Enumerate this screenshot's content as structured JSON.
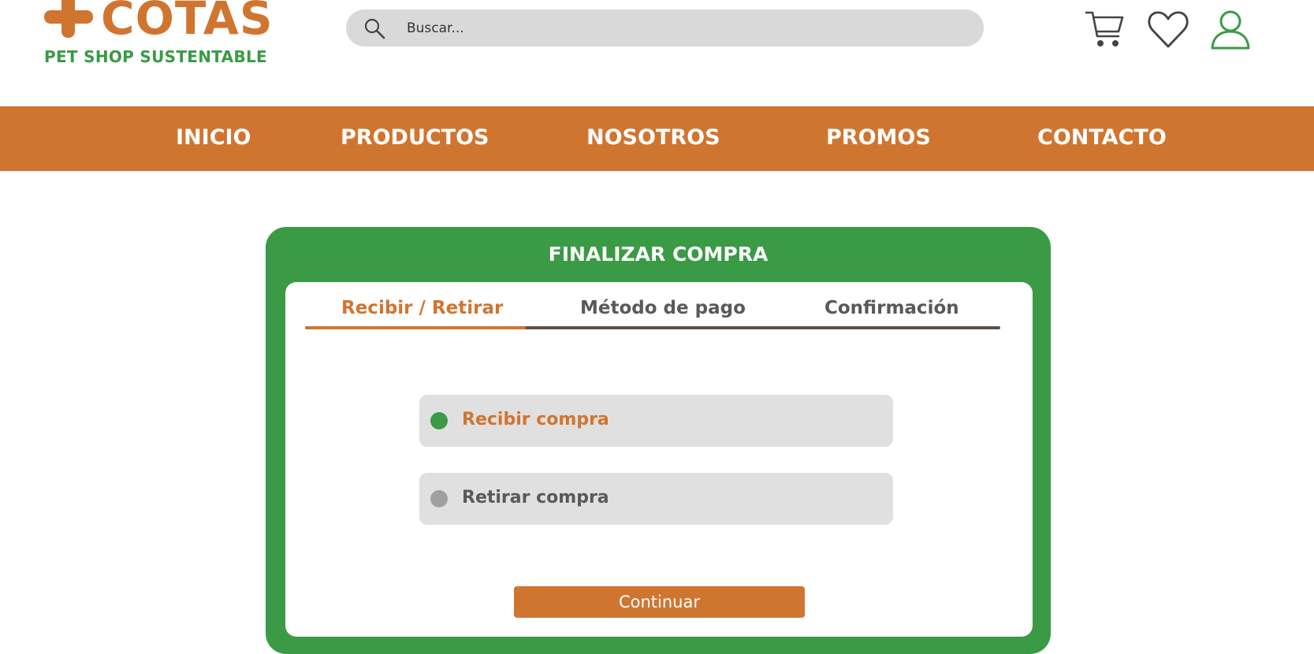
{
  "brand": {
    "name": "COTAS",
    "tagline": "PET SHOP SUSTENTABLE",
    "primary_color": "#d07530",
    "secondary_color": "#3a9a45"
  },
  "header": {
    "search": {
      "placeholder": "Buscar...",
      "value": ""
    },
    "icons": [
      "cart-icon",
      "heart-icon",
      "user-icon"
    ]
  },
  "nav": {
    "items": [
      {
        "label": "INICIO"
      },
      {
        "label": "PRODUCTOS"
      },
      {
        "label": "NOSOTROS"
      },
      {
        "label": "PROMOS"
      },
      {
        "label": "CONTACTO"
      }
    ]
  },
  "checkout": {
    "title": "FINALIZAR COMPRA",
    "steps": [
      {
        "label": "Recibir / Retirar",
        "active": true
      },
      {
        "label": "Método de pago",
        "active": false
      },
      {
        "label": "Confirmación",
        "active": false
      }
    ],
    "options": [
      {
        "label": "Recibir compra",
        "selected": true
      },
      {
        "label": "Retirar compra",
        "selected": false
      }
    ],
    "continue_label": "Continuar"
  }
}
